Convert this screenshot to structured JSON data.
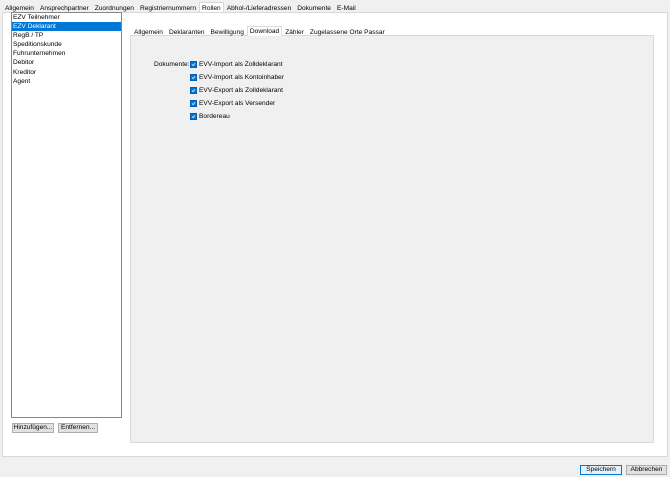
{
  "top_tabs": [
    "Allgemein",
    "Ansprechpartner",
    "Zuordnungen",
    "Registriernummern",
    "Rollen",
    "Abhol-/Lieferadressen",
    "Dokumente",
    "E-Mail"
  ],
  "active_top_tab": 4,
  "roles": [
    "EZV Teilnehmer",
    "EZV Deklarant",
    "RegB / TP",
    "Speditionskunde",
    "Fuhrunternehmen",
    "Debitor",
    "Kreditor",
    "Agent"
  ],
  "selected_role": 1,
  "role_buttons": {
    "add": "Hinzufügen...",
    "remove": "Entfernen..."
  },
  "inner_tabs": [
    "Allgemein",
    "Deklaranten",
    "Bewilligung",
    "Download",
    "Zähler",
    "Zugelassene Orte Passar"
  ],
  "active_inner_tab": 3,
  "download": {
    "label": "Dokumente:",
    "options": [
      {
        "label": "EVV-Import als Zolldeklarant",
        "checked": true
      },
      {
        "label": "EVV-Import als Kontoinhaber",
        "checked": true
      },
      {
        "label": "EVV-Export als Zolldeklarant",
        "checked": true
      },
      {
        "label": "EVV-Export als Versender",
        "checked": true
      },
      {
        "label": "Bordereau",
        "checked": true
      }
    ]
  },
  "footer": {
    "save": "Speichern",
    "cancel": "Abbrechen"
  },
  "colors": {
    "accent": "#0078d7",
    "checkbox": "#0078d7",
    "panel": "#f0f0f0"
  }
}
